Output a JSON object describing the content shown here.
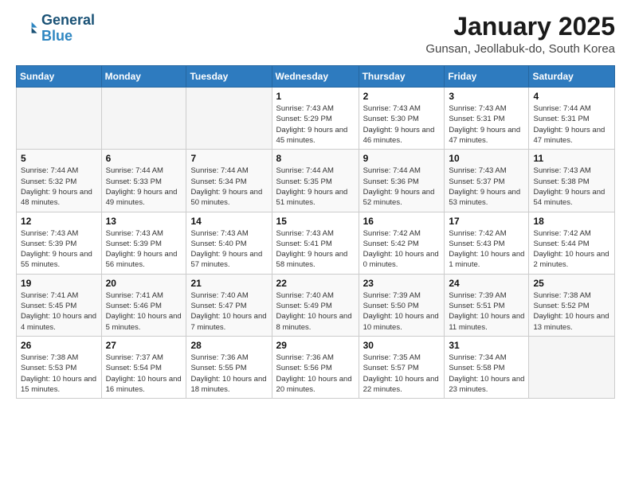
{
  "logo": {
    "line1": "General",
    "line2": "Blue"
  },
  "header": {
    "month": "January 2025",
    "location": "Gunsan, Jeollabuk-do, South Korea"
  },
  "weekdays": [
    "Sunday",
    "Monday",
    "Tuesday",
    "Wednesday",
    "Thursday",
    "Friday",
    "Saturday"
  ],
  "weeks": [
    [
      {
        "day": "",
        "info": ""
      },
      {
        "day": "",
        "info": ""
      },
      {
        "day": "",
        "info": ""
      },
      {
        "day": "1",
        "info": "Sunrise: 7:43 AM\nSunset: 5:29 PM\nDaylight: 9 hours and 45 minutes."
      },
      {
        "day": "2",
        "info": "Sunrise: 7:43 AM\nSunset: 5:30 PM\nDaylight: 9 hours and 46 minutes."
      },
      {
        "day": "3",
        "info": "Sunrise: 7:43 AM\nSunset: 5:31 PM\nDaylight: 9 hours and 47 minutes."
      },
      {
        "day": "4",
        "info": "Sunrise: 7:44 AM\nSunset: 5:31 PM\nDaylight: 9 hours and 47 minutes."
      }
    ],
    [
      {
        "day": "5",
        "info": "Sunrise: 7:44 AM\nSunset: 5:32 PM\nDaylight: 9 hours and 48 minutes."
      },
      {
        "day": "6",
        "info": "Sunrise: 7:44 AM\nSunset: 5:33 PM\nDaylight: 9 hours and 49 minutes."
      },
      {
        "day": "7",
        "info": "Sunrise: 7:44 AM\nSunset: 5:34 PM\nDaylight: 9 hours and 50 minutes."
      },
      {
        "day": "8",
        "info": "Sunrise: 7:44 AM\nSunset: 5:35 PM\nDaylight: 9 hours and 51 minutes."
      },
      {
        "day": "9",
        "info": "Sunrise: 7:44 AM\nSunset: 5:36 PM\nDaylight: 9 hours and 52 minutes."
      },
      {
        "day": "10",
        "info": "Sunrise: 7:43 AM\nSunset: 5:37 PM\nDaylight: 9 hours and 53 minutes."
      },
      {
        "day": "11",
        "info": "Sunrise: 7:43 AM\nSunset: 5:38 PM\nDaylight: 9 hours and 54 minutes."
      }
    ],
    [
      {
        "day": "12",
        "info": "Sunrise: 7:43 AM\nSunset: 5:39 PM\nDaylight: 9 hours and 55 minutes."
      },
      {
        "day": "13",
        "info": "Sunrise: 7:43 AM\nSunset: 5:39 PM\nDaylight: 9 hours and 56 minutes."
      },
      {
        "day": "14",
        "info": "Sunrise: 7:43 AM\nSunset: 5:40 PM\nDaylight: 9 hours and 57 minutes."
      },
      {
        "day": "15",
        "info": "Sunrise: 7:43 AM\nSunset: 5:41 PM\nDaylight: 9 hours and 58 minutes."
      },
      {
        "day": "16",
        "info": "Sunrise: 7:42 AM\nSunset: 5:42 PM\nDaylight: 10 hours and 0 minutes."
      },
      {
        "day": "17",
        "info": "Sunrise: 7:42 AM\nSunset: 5:43 PM\nDaylight: 10 hours and 1 minute."
      },
      {
        "day": "18",
        "info": "Sunrise: 7:42 AM\nSunset: 5:44 PM\nDaylight: 10 hours and 2 minutes."
      }
    ],
    [
      {
        "day": "19",
        "info": "Sunrise: 7:41 AM\nSunset: 5:45 PM\nDaylight: 10 hours and 4 minutes."
      },
      {
        "day": "20",
        "info": "Sunrise: 7:41 AM\nSunset: 5:46 PM\nDaylight: 10 hours and 5 minutes."
      },
      {
        "day": "21",
        "info": "Sunrise: 7:40 AM\nSunset: 5:47 PM\nDaylight: 10 hours and 7 minutes."
      },
      {
        "day": "22",
        "info": "Sunrise: 7:40 AM\nSunset: 5:49 PM\nDaylight: 10 hours and 8 minutes."
      },
      {
        "day": "23",
        "info": "Sunrise: 7:39 AM\nSunset: 5:50 PM\nDaylight: 10 hours and 10 minutes."
      },
      {
        "day": "24",
        "info": "Sunrise: 7:39 AM\nSunset: 5:51 PM\nDaylight: 10 hours and 11 minutes."
      },
      {
        "day": "25",
        "info": "Sunrise: 7:38 AM\nSunset: 5:52 PM\nDaylight: 10 hours and 13 minutes."
      }
    ],
    [
      {
        "day": "26",
        "info": "Sunrise: 7:38 AM\nSunset: 5:53 PM\nDaylight: 10 hours and 15 minutes."
      },
      {
        "day": "27",
        "info": "Sunrise: 7:37 AM\nSunset: 5:54 PM\nDaylight: 10 hours and 16 minutes."
      },
      {
        "day": "28",
        "info": "Sunrise: 7:36 AM\nSunset: 5:55 PM\nDaylight: 10 hours and 18 minutes."
      },
      {
        "day": "29",
        "info": "Sunrise: 7:36 AM\nSunset: 5:56 PM\nDaylight: 10 hours and 20 minutes."
      },
      {
        "day": "30",
        "info": "Sunrise: 7:35 AM\nSunset: 5:57 PM\nDaylight: 10 hours and 22 minutes."
      },
      {
        "day": "31",
        "info": "Sunrise: 7:34 AM\nSunset: 5:58 PM\nDaylight: 10 hours and 23 minutes."
      },
      {
        "day": "",
        "info": ""
      }
    ]
  ]
}
